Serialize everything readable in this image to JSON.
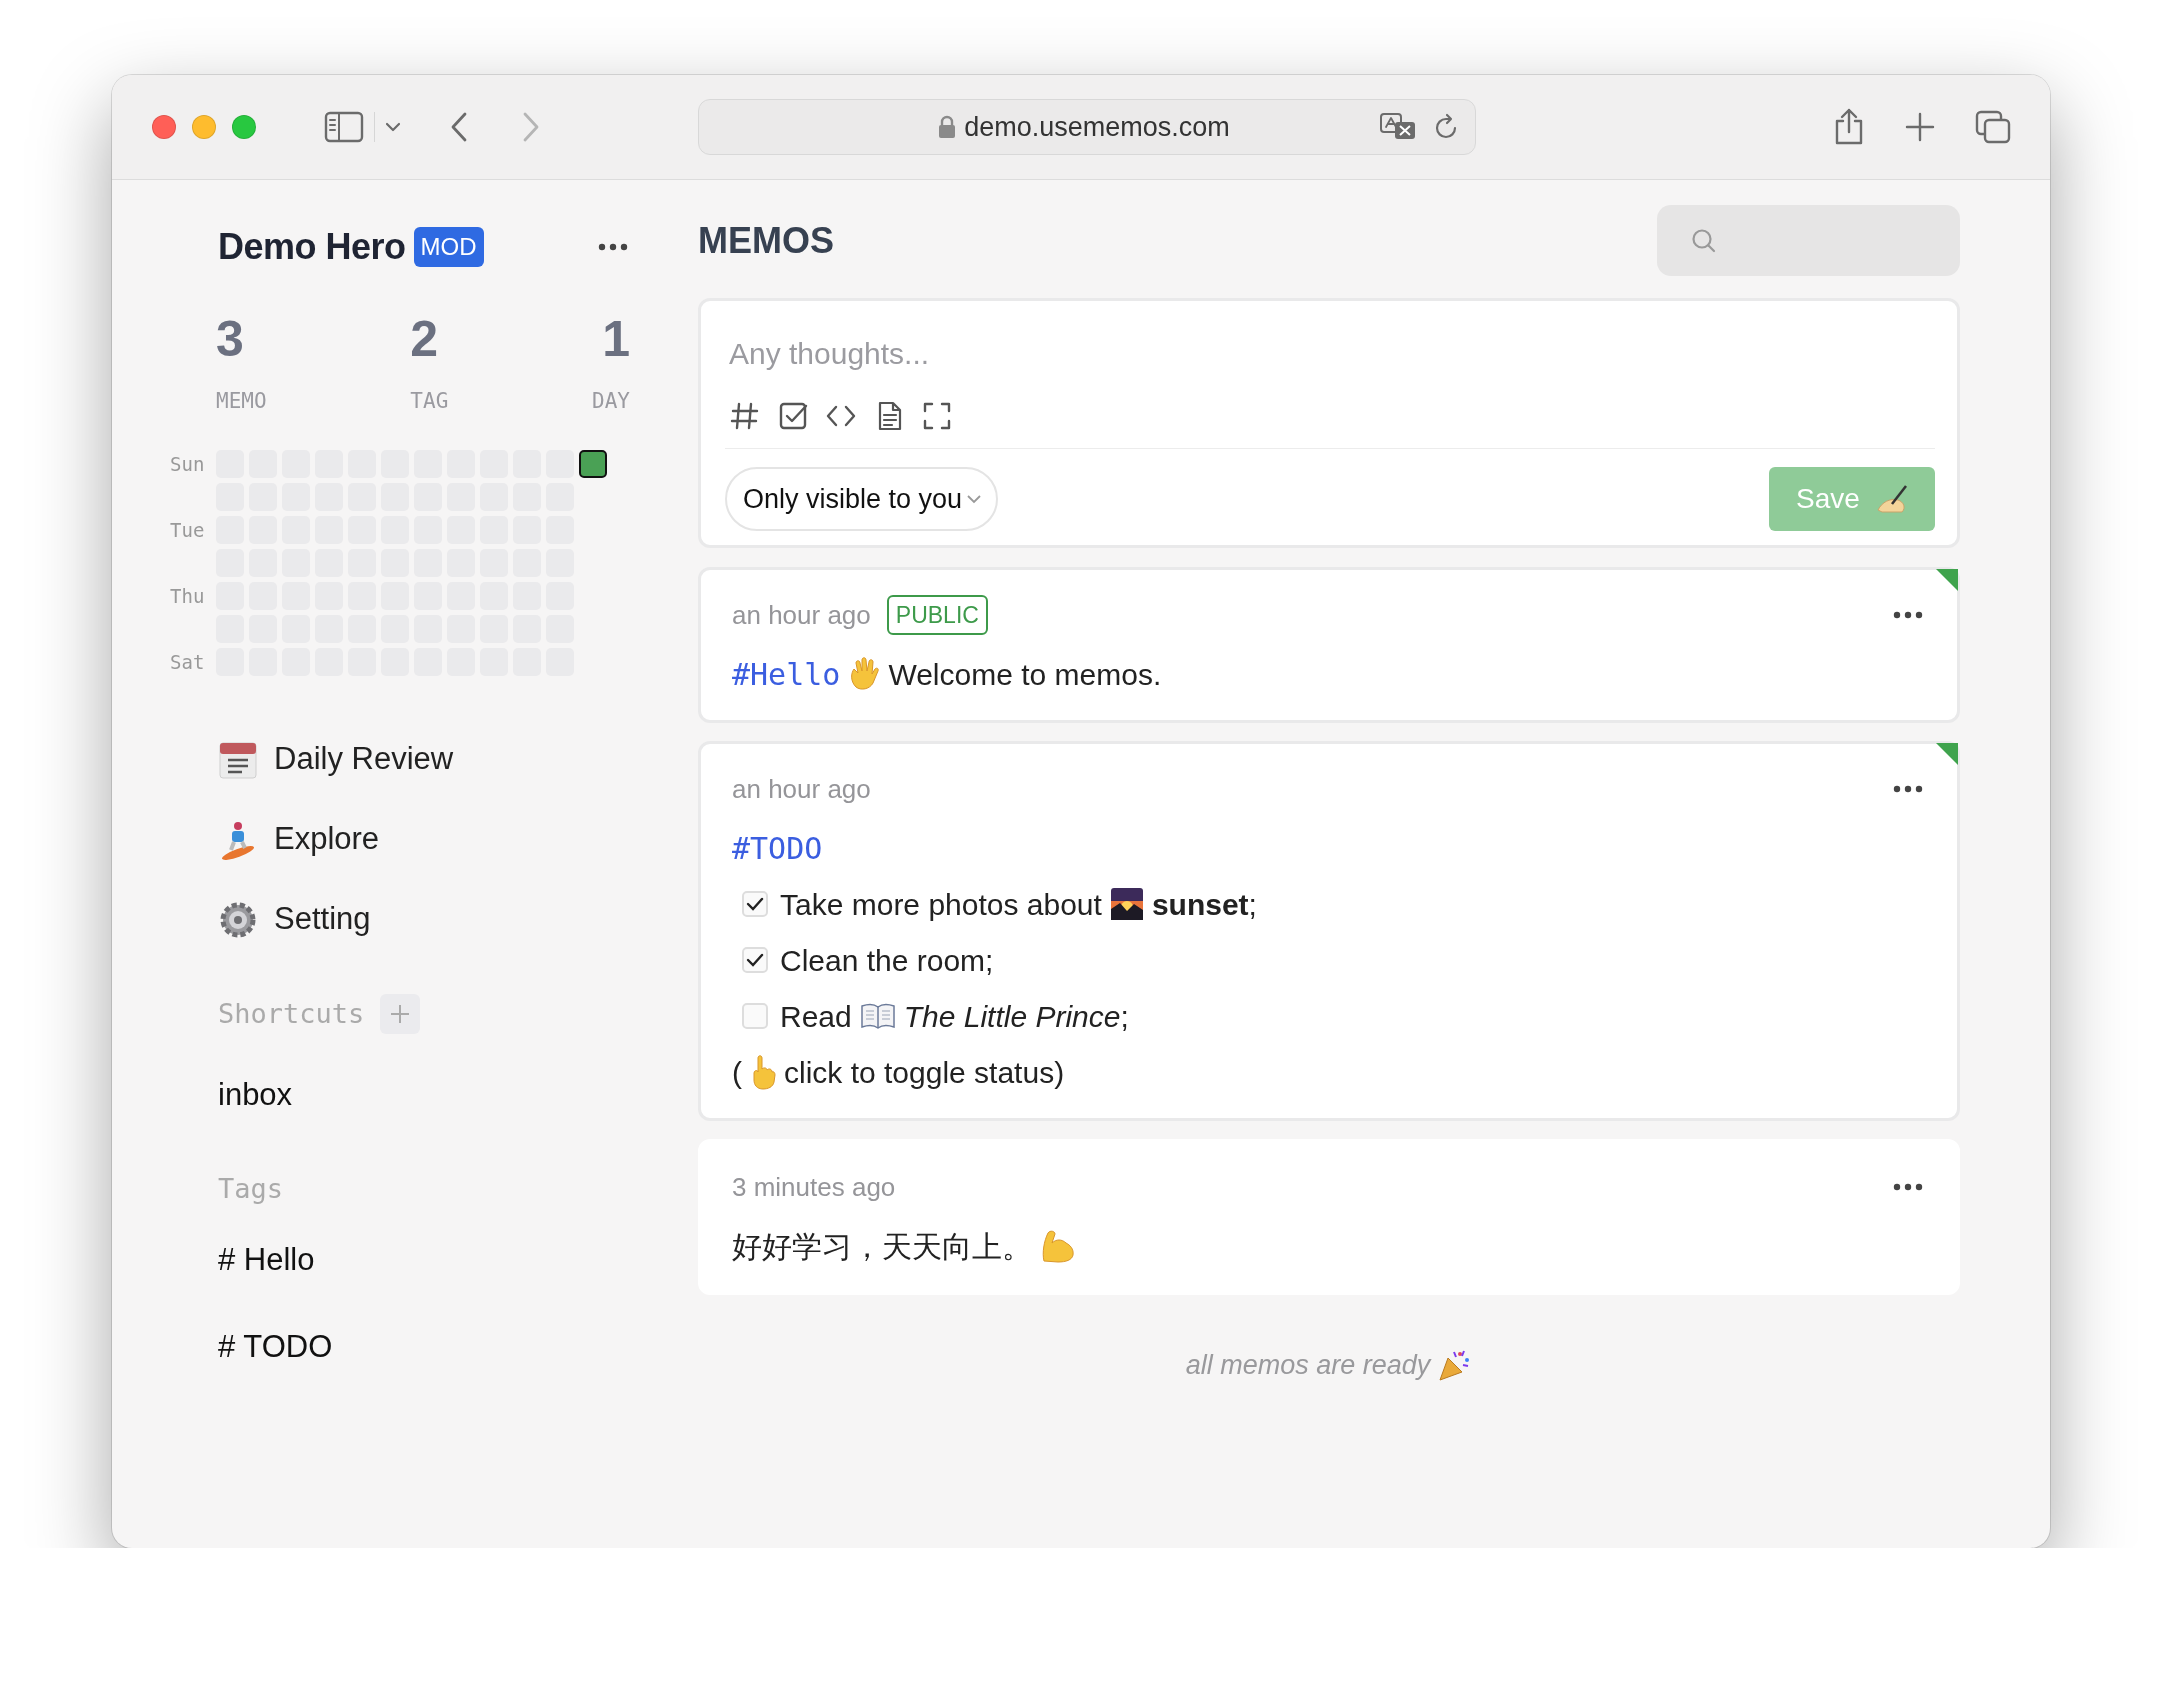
{
  "browser": {
    "url": "demo.usememos.com"
  },
  "user": {
    "name": "Demo Hero",
    "role": "MOD"
  },
  "stats": [
    {
      "value": "3",
      "label": "MEMO"
    },
    {
      "value": "2",
      "label": "TAG"
    },
    {
      "value": "1",
      "label": "DAY"
    }
  ],
  "heatmap": {
    "day_labels": [
      "Sun",
      "Tue",
      "Thu",
      "Sat"
    ],
    "weeks": [
      [
        false,
        false,
        false,
        false,
        false,
        false,
        false
      ],
      [
        false,
        false,
        false,
        false,
        false,
        false,
        false
      ],
      [
        false,
        false,
        false,
        false,
        false,
        false,
        false
      ],
      [
        false,
        false,
        false,
        false,
        false,
        false,
        false
      ],
      [
        false,
        false,
        false,
        false,
        false,
        false,
        false
      ],
      [
        false,
        false,
        false,
        false,
        false,
        false,
        false
      ],
      [
        false,
        false,
        false,
        false,
        false,
        false,
        false
      ],
      [
        false,
        false,
        false,
        false,
        false,
        false,
        false
      ],
      [
        false,
        false,
        false,
        false,
        false,
        false,
        false
      ],
      [
        false,
        false,
        false,
        false,
        false,
        false,
        false
      ],
      [
        false,
        false,
        false,
        false,
        false,
        false,
        false
      ],
      [
        true
      ]
    ]
  },
  "nav": [
    {
      "kind": "calendar",
      "label": "Daily Review"
    },
    {
      "kind": "snowboarder",
      "label": "Explore"
    },
    {
      "kind": "gear",
      "label": "Setting"
    }
  ],
  "shortcuts": {
    "title": "Shortcuts",
    "items": [
      {
        "label": "inbox"
      }
    ]
  },
  "tags": {
    "title": "Tags",
    "items": [
      {
        "label": "# Hello"
      },
      {
        "label": "# TODO"
      }
    ]
  },
  "header": {
    "title": "MEMOS"
  },
  "editor": {
    "placeholder": "Any thoughts...",
    "visibility": "Only visible to you",
    "save": {
      "label": "Save",
      "disabled": true
    }
  },
  "memos": [
    {
      "time": "an hour ago",
      "visibility": "PUBLIC",
      "pinned": true,
      "lines": [
        {
          "kind": "line",
          "segments": [
            {
              "kind": "tag",
              "text": "#Hello"
            },
            {
              "kind": "wave"
            },
            {
              "kind": "text",
              "text": "Welcome to memos."
            }
          ]
        }
      ]
    },
    {
      "time": "an hour ago",
      "pinned": true,
      "lines": [
        {
          "kind": "line",
          "segments": [
            {
              "kind": "tag",
              "text": "#TODO"
            }
          ]
        },
        {
          "kind": "task",
          "checked": true,
          "segments": [
            {
              "kind": "text",
              "text": "Take more photos about"
            },
            {
              "kind": "sunset"
            },
            {
              "kind": "text",
              "text": "**sunset**;"
            }
          ]
        },
        {
          "kind": "task",
          "checked": true,
          "segments": [
            {
              "kind": "text",
              "text": "Clean the room;"
            }
          ]
        },
        {
          "kind": "task",
          "checked": false,
          "segments": [
            {
              "kind": "text",
              "text": "Read"
            },
            {
              "kind": "book"
            },
            {
              "kind": "text",
              "text": "*The Little Prince*;"
            }
          ]
        },
        {
          "kind": "line",
          "segments": [
            {
              "kind": "text",
              "text": "("
            },
            {
              "kind": "pointing"
            },
            {
              "kind": "text",
              "text": "click to toggle status)"
            }
          ]
        }
      ]
    },
    {
      "time": "3 minutes ago",
      "pinned": false,
      "lines": [
        {
          "kind": "line",
          "segments": [
            {
              "kind": "text",
              "text": "好好学习，天天向上。"
            },
            {
              "kind": "muscle"
            }
          ]
        }
      ]
    }
  ],
  "footer": {
    "text": "all memos are ready"
  }
}
